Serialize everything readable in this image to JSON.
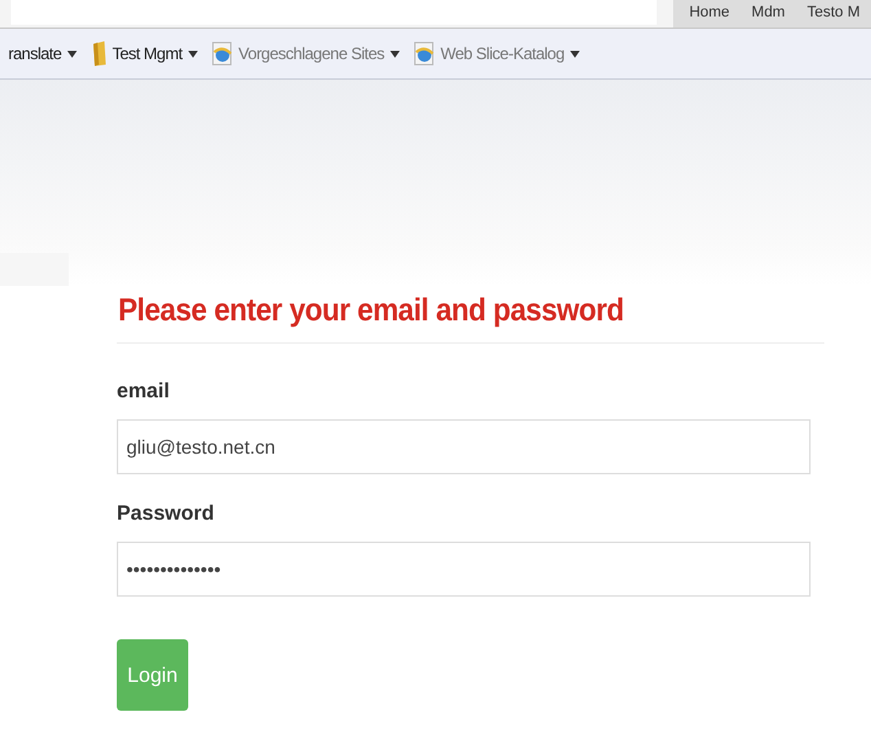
{
  "browser_tabs": [
    {
      "label": "Home"
    },
    {
      "label": "Mdm"
    },
    {
      "label": "Testo M"
    }
  ],
  "favorites_bar": [
    {
      "label": "ranslate",
      "kind": "plain"
    },
    {
      "label": "Test Mgmt",
      "kind": "folder"
    },
    {
      "label": "Vorgeschlagene Sites",
      "kind": "ie"
    },
    {
      "label": "Web Slice-Katalog",
      "kind": "ie"
    }
  ],
  "form": {
    "heading": "Please enter your email and password",
    "fields": [
      {
        "label": "email",
        "value": "gliu@testo.net.cn"
      },
      {
        "label": "Password",
        "value": "••••••••••••••"
      }
    ],
    "submit": "Login"
  }
}
